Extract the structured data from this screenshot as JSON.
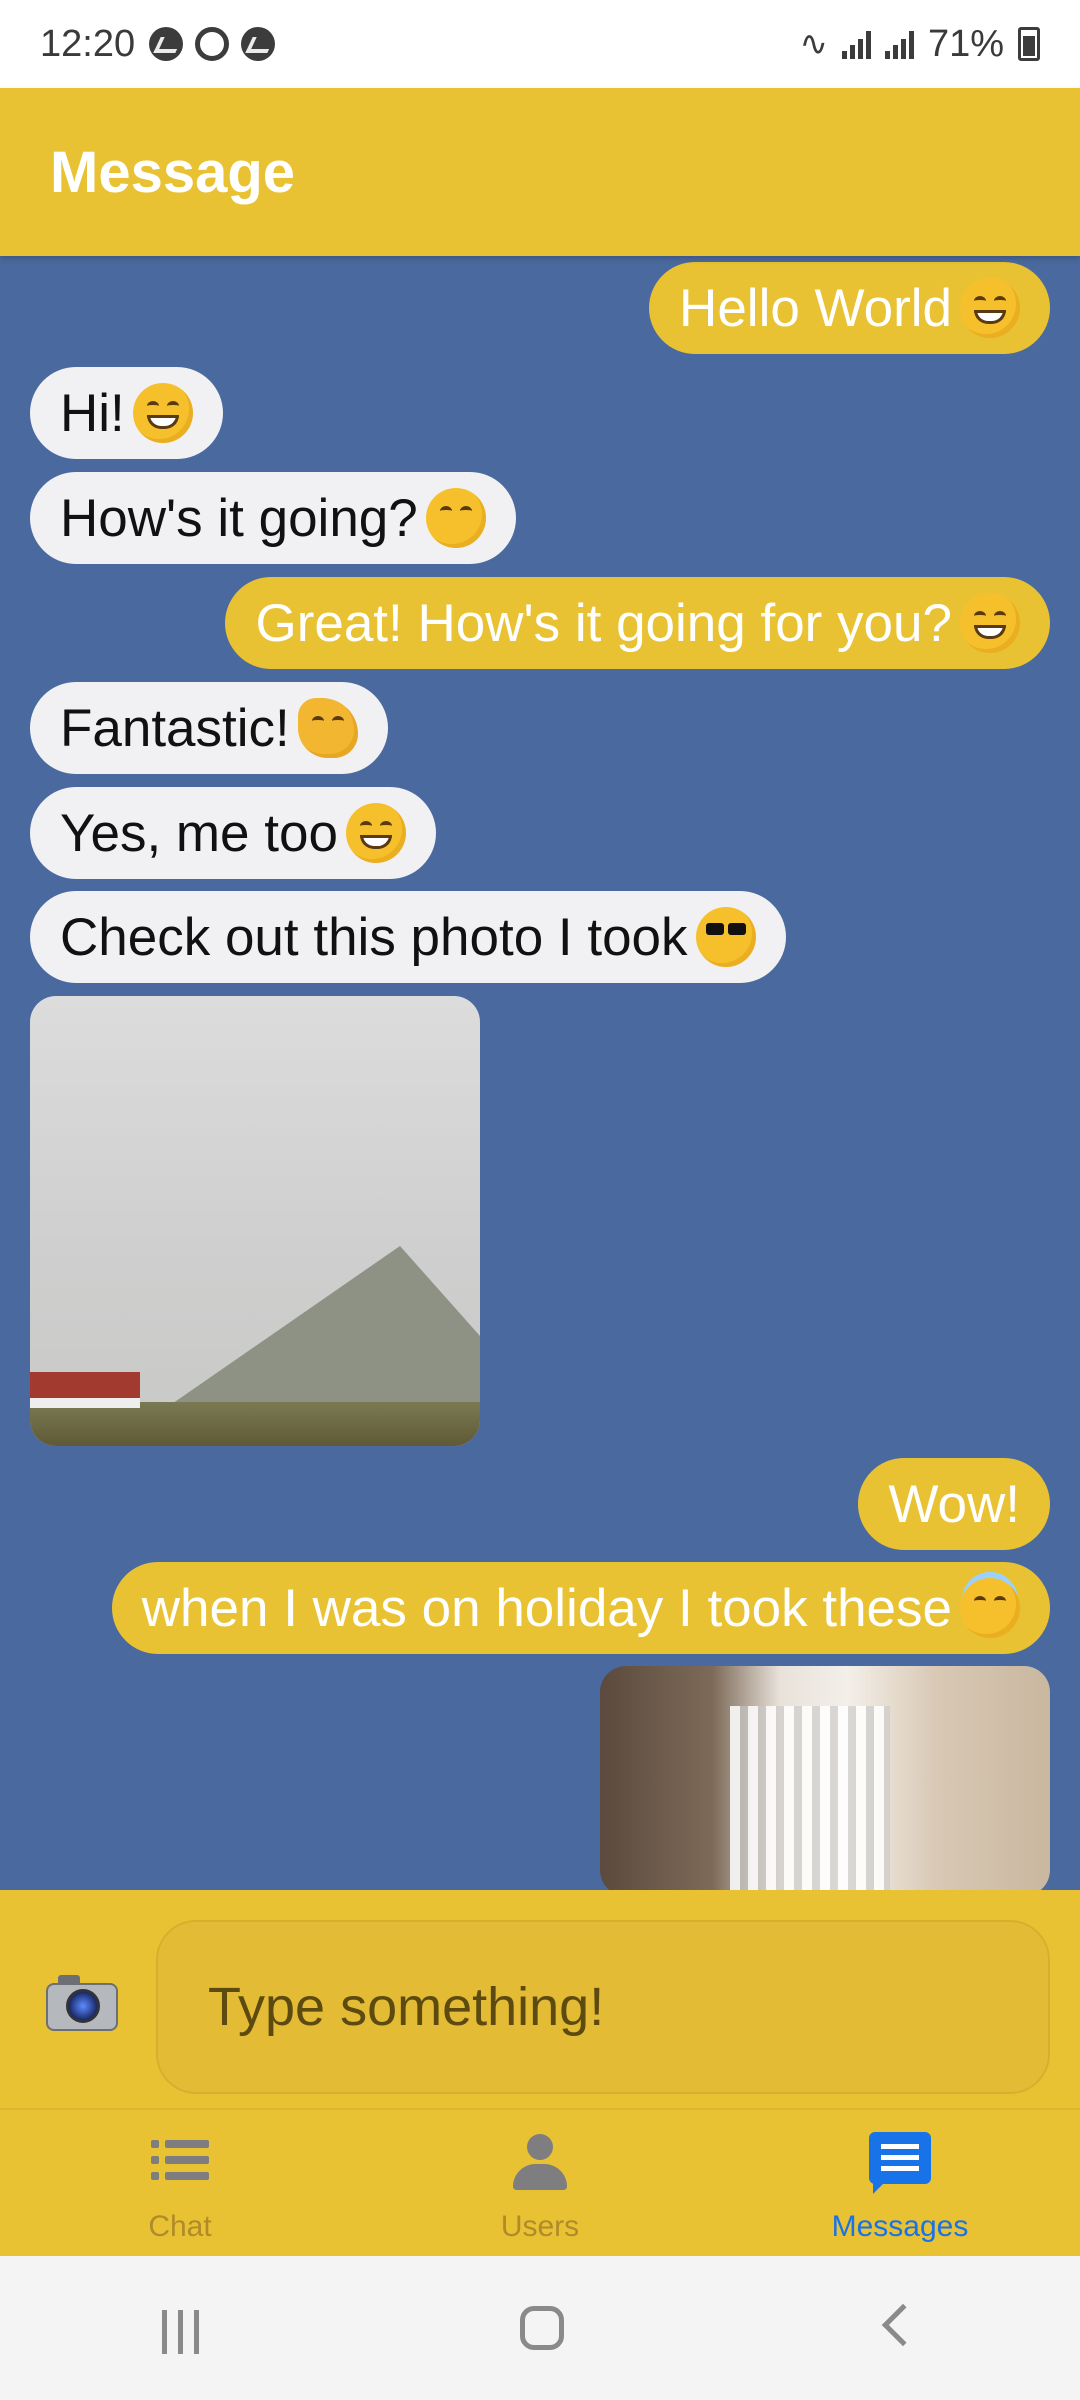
{
  "status_bar": {
    "time": "12:20",
    "battery": "71%"
  },
  "header": {
    "title": "Message"
  },
  "messages": [
    {
      "text": "Hello World",
      "direction": "out",
      "emoji": "grinning-face"
    },
    {
      "text": "Hi!",
      "direction": "in",
      "emoji": "grinning-face"
    },
    {
      "text": "How's it going?",
      "direction": "in",
      "emoji": "smiling-face"
    },
    {
      "text": "Great! How's it going for you?",
      "direction": "out",
      "emoji": "grinning-face"
    },
    {
      "text": "Fantastic!",
      "direction": "in",
      "emoji": "clapping-hands"
    },
    {
      "text": "Yes, me too",
      "direction": "in",
      "emoji": "grinning-sweat"
    },
    {
      "text": "Check out this photo I took",
      "direction": "in",
      "emoji": "sunglasses-face"
    },
    {
      "text": "Wow!",
      "direction": "out"
    },
    {
      "text": "when I was on holiday I took these",
      "direction": "out",
      "emoji": "halo-face"
    }
  ],
  "composer": {
    "placeholder": "Type something!",
    "camera_icon": "camera-icon"
  },
  "bottom_nav": {
    "items": [
      {
        "label": "Chat",
        "icon": "list-icon",
        "active": false
      },
      {
        "label": "Users",
        "icon": "person-icon",
        "active": false
      },
      {
        "label": "Messages",
        "icon": "message-icon",
        "active": true
      }
    ]
  },
  "colors": {
    "accent": "#e9c233",
    "chat_background": "#4a6a9f",
    "incoming_bubble": "#f1f1f3",
    "active_nav": "#1973e8"
  }
}
